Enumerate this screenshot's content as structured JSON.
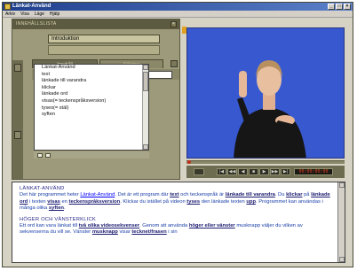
{
  "window": {
    "title": "Länkat-Använd",
    "controls": [
      "_",
      "□",
      "×"
    ]
  },
  "menu": [
    "Arkiv",
    "Visa",
    "Läge",
    "Hjälp"
  ],
  "panel": {
    "header": "INNEHÅLLSLISTA",
    "title_value": "Introduktion",
    "tabs": [
      "Innehåll",
      "Sökning"
    ],
    "list_items": [
      "Länkat-Använd",
      "text",
      "länkade till varandra",
      "klickar",
      "länkade ord",
      "visas(= teckenspråksversion)",
      "tyses(= stäl)",
      "syften"
    ]
  },
  "player": {
    "counter": "00:00:00:00",
    "buttons": [
      "|◀",
      "◀◀",
      "◀",
      "■",
      "▶",
      "▶▶",
      "▶|"
    ]
  },
  "content": {
    "h1": "LÄNKAT-ANVÄND",
    "p1_a": "Det här programmet heter",
    "p1_link": "Länkat-Använd",
    "p1_b": ". Det är ett program där",
    "p1_bold1": "text",
    "p1_c": "och teckenspråk är",
    "p1_bold2": "länkade till varandra",
    "p1_d": ". Du",
    "p1_bold3": "klickar",
    "p1_e": "på",
    "p1_bold4": "länkade ord",
    "p1_f": "i texten",
    "p1_bold5": "visas",
    "p1_g": "en",
    "p1_bold6": "teckenspråksversion",
    "p1_h": ". Klickar du istället på videon",
    "p1_bold7": "tyses",
    "p1_i": "den länkade texten",
    "p1_bold8": "upp",
    "p1_j": ".",
    "p1_k": "Programmet kan användas i många olika",
    "p1_bold9": "syften",
    "p1_l": ".",
    "h2": "HÖGER OCH VÄNSTERKLICK",
    "p2_a": "Ett ord kan vara länkat till",
    "p2_bold1": "två olika videosekvenser",
    "p2_b": ". Genom att använda",
    "p2_bold2": "höger eller vänster",
    "p2_c": "musknapp väljer du vilken av sekvenserna du vill se. Vänster",
    "p2_bold3": "musknapp",
    "p2_d": "visar",
    "p2_bold4": "tecknet/frasen",
    "p2_e": "i sin"
  },
  "colors": {
    "video_bg": "#3858d0",
    "panel": "#9c9a7a",
    "titlebar": "#1f3f8c",
    "link": "#0000ff"
  }
}
